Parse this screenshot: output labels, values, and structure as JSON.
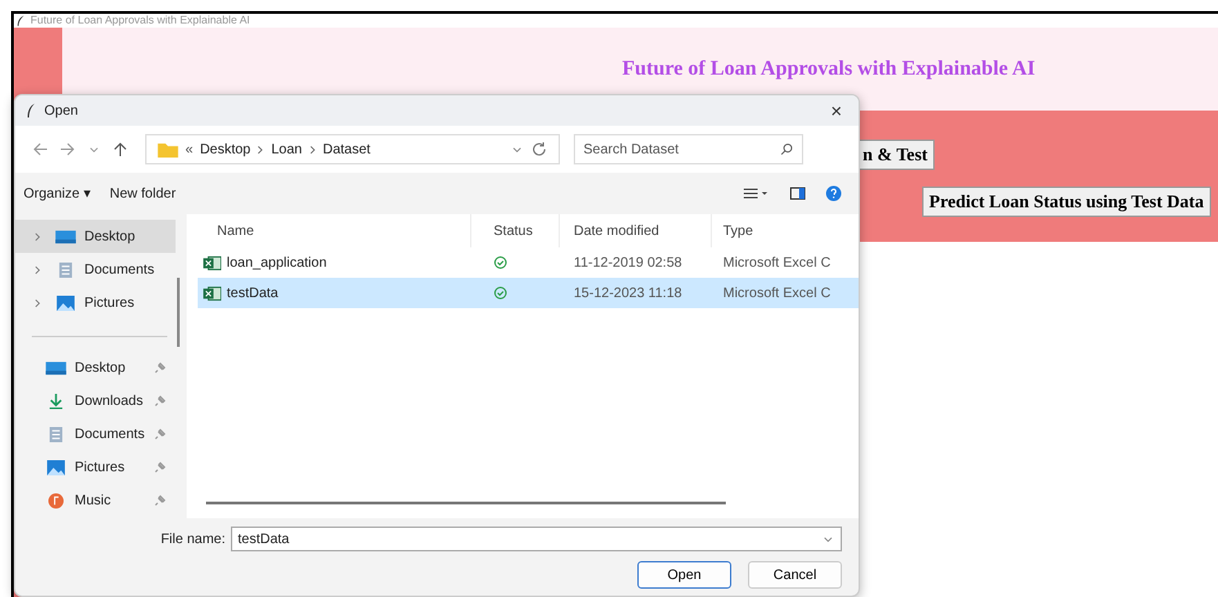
{
  "window": {
    "title": "Future of Loan Approvals with Explainable AI"
  },
  "app": {
    "heading": "Future of Loan Approvals with Explainable AI",
    "buttons": [
      {
        "label": "n & Test"
      },
      {
        "label": "Predict Loan Status using Test Data"
      }
    ]
  },
  "dialog": {
    "title": "Open",
    "close": "×",
    "path_overflow": "«",
    "path": [
      "Desktop",
      "Loan",
      "Dataset"
    ],
    "search": {
      "placeholder": "Search Dataset"
    },
    "toolbar": [
      "Organize ▾",
      "New folder"
    ],
    "sidebar": [
      {
        "label": "Desktop",
        "kind": "tree",
        "selected": true
      },
      {
        "label": "Documents",
        "kind": "tree",
        "selected": false
      },
      {
        "label": "Pictures",
        "kind": "tree",
        "selected": false
      },
      {
        "label": "Desktop",
        "kind": "pinned",
        "selected": false
      },
      {
        "label": "Downloads",
        "kind": "pinned",
        "selected": false
      },
      {
        "label": "Documents",
        "kind": "pinned",
        "selected": false
      },
      {
        "label": "Pictures",
        "kind": "pinned",
        "selected": false
      },
      {
        "label": "Music",
        "kind": "pinned",
        "selected": false
      }
    ],
    "columns": [
      "Name",
      "Status",
      "Date modified",
      "Type"
    ],
    "files": [
      {
        "name": "loan_application",
        "date": "11-12-2019 02:58",
        "type": "Microsoft Excel C",
        "selected": false
      },
      {
        "name": "testData",
        "date": "15-12-2023 11:18",
        "type": "Microsoft Excel C",
        "selected": true
      }
    ],
    "file_name": {
      "label": "File name:",
      "value": "testData"
    },
    "buttons": [
      {
        "label": "Open",
        "default": true
      },
      {
        "label": "Cancel",
        "default": false
      }
    ]
  }
}
